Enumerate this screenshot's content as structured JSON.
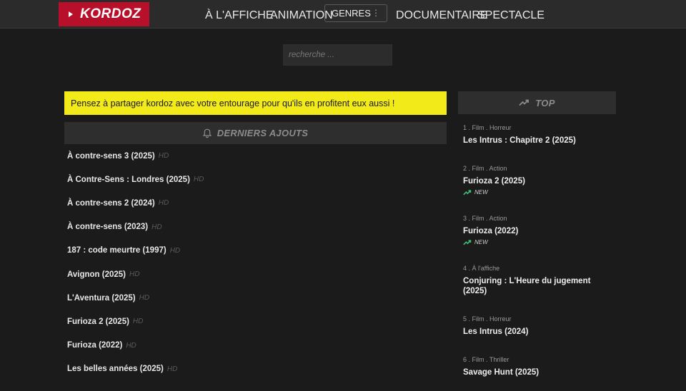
{
  "header": {
    "logo_text": "KORDOZ",
    "nav": [
      {
        "label": "À L'AFFICHE"
      },
      {
        "label": "ANIMATION"
      },
      {
        "label": "GENRES"
      },
      {
        "label": "DOCUMENTAIRE"
      },
      {
        "label": "SPECTACLE"
      }
    ]
  },
  "search": {
    "placeholder": "recherche ..."
  },
  "notice": {
    "text": "Pensez à partager kordoz avec votre entourage pour qu'ils en profitent eux aussi !"
  },
  "latest": {
    "heading": "DERNIERS AJOUTS",
    "items": [
      {
        "title": "À contre-sens 3 (2025)",
        "quality": "HD"
      },
      {
        "title": "À Contre-Sens : Londres (2025)",
        "quality": "HD"
      },
      {
        "title": "À contre-sens 2 (2024)",
        "quality": "HD"
      },
      {
        "title": "À contre-sens (2023)",
        "quality": "HD"
      },
      {
        "title": "187 : code meurtre (1997)",
        "quality": "HD"
      },
      {
        "title": "Avignon (2025)",
        "quality": "HD"
      },
      {
        "title": "L'Aventura (2025)",
        "quality": "HD"
      },
      {
        "title": "Furioza 2 (2025)",
        "quality": "HD"
      },
      {
        "title": "Furioza (2022)",
        "quality": "HD"
      },
      {
        "title": "Les belles années (2025)",
        "quality": "HD"
      }
    ]
  },
  "top": {
    "heading": "TOP",
    "items": [
      {
        "meta": "1 . Film . Horreur",
        "title": "Les Intrus : Chapitre 2 (2025)",
        "badge": ""
      },
      {
        "meta": "2 . Film . Action",
        "title": "Furioza 2 (2025)",
        "badge": "NEW"
      },
      {
        "meta": "3 . Film . Action",
        "title": "Furioza (2022)",
        "badge": "NEW"
      },
      {
        "meta": "4 . À l'affiche",
        "title": "Conjuring : L'Heure du jugement (2025)",
        "badge": ""
      },
      {
        "meta": "5 . Film . Horreur",
        "title": "Les Intrus (2024)",
        "badge": ""
      },
      {
        "meta": "6 . Film . Thriller",
        "title": "Savage Hunt (2025)",
        "badge": ""
      }
    ]
  },
  "colors": {
    "logo_bg": "#b8102a",
    "notice_bg": "#f3ea1a",
    "trend_green": "#3fbf7f"
  }
}
